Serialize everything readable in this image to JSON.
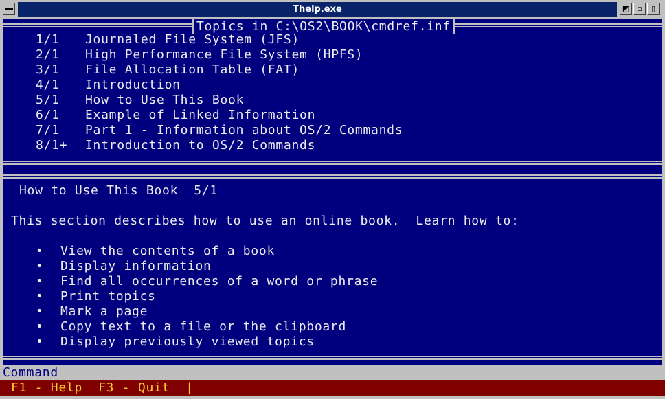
{
  "window": {
    "title": "Thelp.exe"
  },
  "topics_panel": {
    "caption": "Topics in C:\\OS2\\BOOK\\cmdref.inf",
    "items": [
      {
        "number": "1/1",
        "title": "Journaled File System (JFS)"
      },
      {
        "number": "2/1",
        "title": "High Performance File System (HPFS)"
      },
      {
        "number": "3/1",
        "title": "File Allocation Table (FAT)"
      },
      {
        "number": "4/1",
        "title": "Introduction"
      },
      {
        "number": "5/1",
        "title": "How to Use This Book"
      },
      {
        "number": "6/1",
        "title": "Example of Linked Information"
      },
      {
        "number": "7/1",
        "title": "Part 1 - Information about OS/2 Commands"
      },
      {
        "number": "8/1+",
        "title": "Introduction to OS/2 Commands"
      }
    ]
  },
  "content": {
    "heading": "How to Use This Book  5/1",
    "intro": "This section describes how to use an online book.  Learn how to:",
    "bullet_glyph": "•",
    "bullets": [
      "View the contents of a book",
      "Display information",
      "Find all occurrences of a word or phrase",
      "Print topics",
      "Mark a page",
      "Copy text to a file or the clipboard",
      "Display previously viewed topics"
    ]
  },
  "command_line": {
    "label": "Command"
  },
  "function_keys": {
    "text": "F1 - Help  F3 - Quit  |"
  },
  "colors": {
    "background": "#00007f",
    "text": "#ececec",
    "frame": "#c0c0c0",
    "key_bar": "#800000",
    "key_text": "#ffcc33"
  }
}
